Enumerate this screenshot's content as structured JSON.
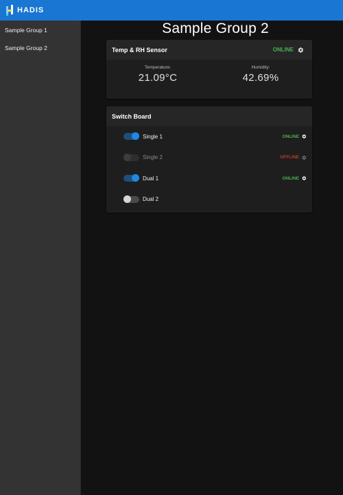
{
  "app": {
    "logo_text": "HADIS"
  },
  "sidebar": {
    "items": [
      {
        "label": "Sample Group 1"
      },
      {
        "label": "Sample Group 2"
      }
    ]
  },
  "main": {
    "title": "Sample Group 2",
    "sensor_card": {
      "title": "Temp & RH Sensor",
      "status": "ONLINE",
      "temperature_label": "Temperature:",
      "temperature_value": "21.09°C",
      "humidity_label": "Humidity:",
      "humidity_value": "42.69%"
    },
    "switch_card": {
      "title": "Switch Board",
      "switches": [
        {
          "name": "Single 1",
          "state": "on",
          "status": "ONLINE"
        },
        {
          "name": "Single 2",
          "state": "disabled",
          "status": "OFFLINE"
        },
        {
          "name": "Dual 1",
          "state": "on",
          "status": "ONLINE"
        },
        {
          "name": "Dual 2",
          "state": "off",
          "status": ""
        }
      ]
    }
  },
  "colors": {
    "appbar": "#1976d2",
    "online": "#4caf50",
    "offline": "#c0392b",
    "toggle_on": "#1e88e5"
  },
  "icons": {
    "settings": "gear-icon",
    "logo": "hadis-logo-icon"
  }
}
